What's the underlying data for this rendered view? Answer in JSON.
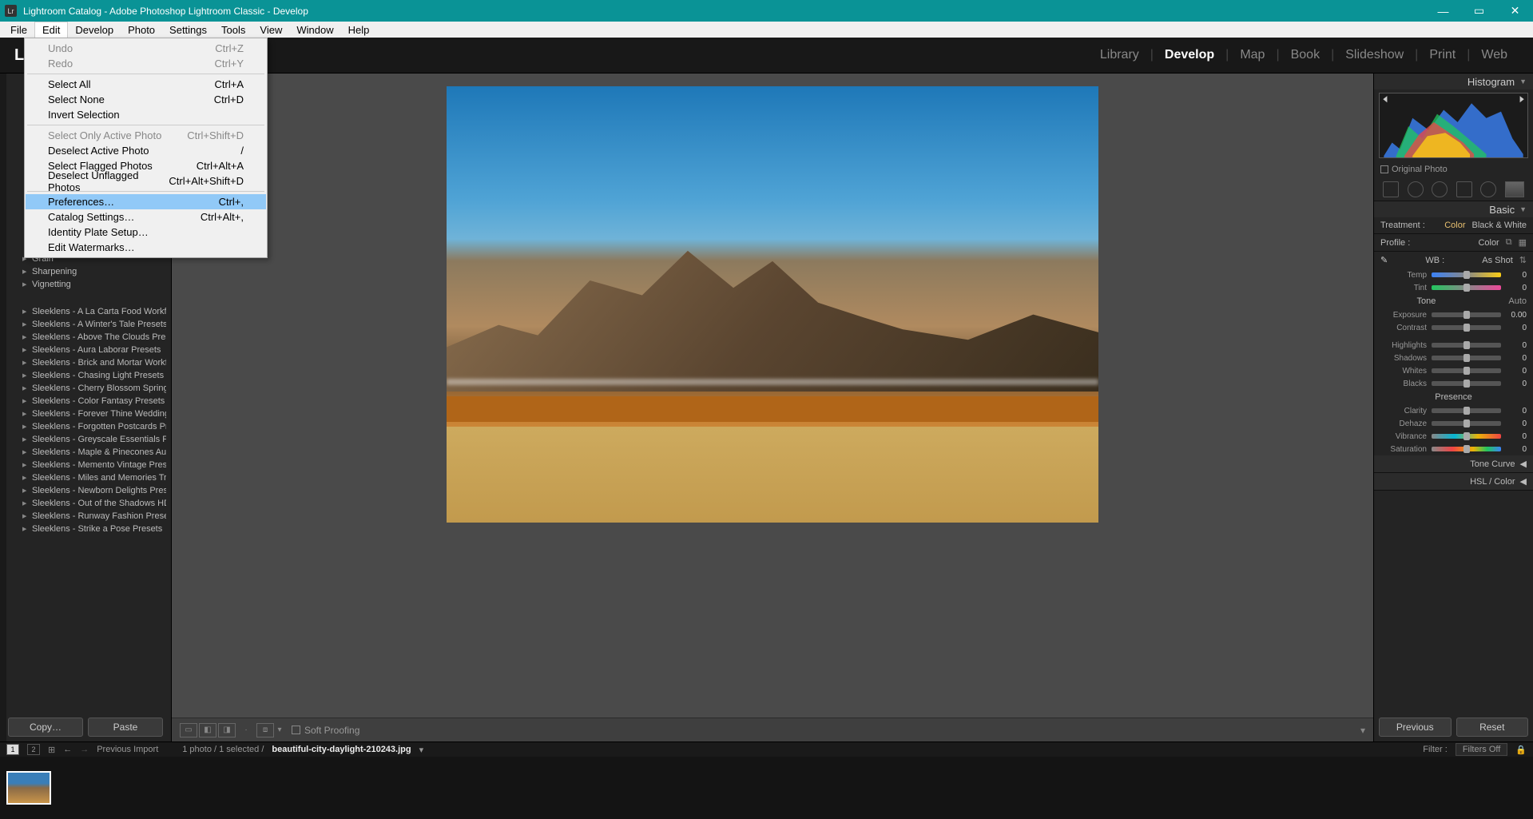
{
  "titlebar": {
    "lr_badge": "Lr",
    "text": "Lightroom Catalog - Adobe Photoshop Lightroom Classic - Develop"
  },
  "menubar": [
    "File",
    "Edit",
    "Develop",
    "Photo",
    "Settings",
    "Tools",
    "View",
    "Window",
    "Help"
  ],
  "edit_menu": {
    "undo": {
      "label": "Undo",
      "shortcut": "Ctrl+Z",
      "disabled": true
    },
    "redo": {
      "label": "Redo",
      "shortcut": "Ctrl+Y",
      "disabled": true
    },
    "selectall": {
      "label": "Select All",
      "shortcut": "Ctrl+A"
    },
    "selectnone": {
      "label": "Select None",
      "shortcut": "Ctrl+D"
    },
    "invertsel": {
      "label": "Invert Selection",
      "shortcut": ""
    },
    "selonly": {
      "label": "Select Only Active Photo",
      "shortcut": "Ctrl+Shift+D",
      "disabled": true
    },
    "desact": {
      "label": "Deselect Active Photo",
      "shortcut": "/"
    },
    "selflag": {
      "label": "Select Flagged Photos",
      "shortcut": "Ctrl+Alt+A"
    },
    "desunflag": {
      "label": "Deselect Unflagged Photos",
      "shortcut": "Ctrl+Alt+Shift+D"
    },
    "prefs": {
      "label": "Preferences…",
      "shortcut": "Ctrl+,"
    },
    "catset": {
      "label": "Catalog Settings…",
      "shortcut": "Ctrl+Alt+,"
    },
    "idplate": {
      "label": "Identity Plate Setup…",
      "shortcut": ""
    },
    "waterm": {
      "label": "Edit Watermarks…",
      "shortcut": ""
    }
  },
  "modules": {
    "library": "Library",
    "develop": "Develop",
    "map": "Map",
    "book": "Book",
    "slideshow": "Slideshow",
    "print": "Print",
    "web": "Web"
  },
  "brand": "L",
  "left_presets_top": [
    "Grain",
    "Sharpening",
    "Vignetting"
  ],
  "left_presets": [
    "Sleeklens - A La Carta Food Workflo…",
    "Sleeklens - A Winter's Tale Presets",
    "Sleeklens - Above The Clouds Presets",
    "Sleeklens - Aura Laborar Presets",
    "Sleeklens - Brick and Mortar Workfl…",
    "Sleeklens - Chasing Light Presets",
    "Sleeklens - Cherry Blossom Spring …",
    "Sleeklens - Color Fantasy Presets",
    "Sleeklens - Forever Thine Wedding …",
    "Sleeklens - Forgotten Postcards Pre…",
    "Sleeklens - Greyscale Essentials Pres…",
    "Sleeklens - Maple & Pinecones Autu…",
    "Sleeklens - Memento Vintage Presets",
    "Sleeklens - Miles and Memories Tra…",
    "Sleeklens - Newborn Delights Presets",
    "Sleeklens - Out of the Shadows HD…",
    "Sleeklens - Runway Fashion Presets",
    "Sleeklens - Strike a Pose Presets"
  ],
  "left_buttons": {
    "copy": "Copy…",
    "paste": "Paste"
  },
  "center_toolbar": {
    "soft": "Soft Proofing"
  },
  "right": {
    "histogram": "Histogram",
    "original": "Original Photo",
    "basic": "Basic",
    "treatment": "Treatment :",
    "color": "Color",
    "bw": "Black & White",
    "profile": "Profile :",
    "profval": "Color",
    "wb": "WB :",
    "wbval": "As Shot",
    "temp": "Temp",
    "tint": "Tint",
    "tone": "Tone",
    "auto": "Auto",
    "exposure": "Exposure",
    "expval": "0.00",
    "contrast": "Contrast",
    "highlights": "Highlights",
    "shadows": "Shadows",
    "whites": "Whites",
    "blacks": "Blacks",
    "presence": "Presence",
    "clarity": "Clarity",
    "dehaze": "Dehaze",
    "vibrance": "Vibrance",
    "saturation": "Saturation",
    "zero": "0",
    "tonecurve": "Tone Curve",
    "hsl": "HSL / Color",
    "previous": "Previous",
    "reset": "Reset"
  },
  "status": {
    "one": "1",
    "two": "2",
    "prevImport": "Previous Import",
    "count": "1 photo / 1 selected /",
    "file": "beautiful-city-daylight-210243.jpg",
    "filter": "Filter :",
    "filtersoff": "Filters Off"
  }
}
